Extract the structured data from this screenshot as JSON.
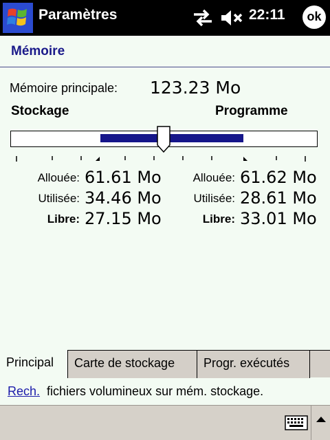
{
  "titlebar": {
    "app_title": "Paramètres",
    "clock": "22:11",
    "ok_label": "ok",
    "icons": [
      "windows-start-icon",
      "sync-arrows-icon",
      "volume-muted-icon"
    ]
  },
  "page": {
    "title": "Mémoire"
  },
  "memory": {
    "main_label": "Mémoire principale:",
    "main_value": "123.23 Mo",
    "storage_label": "Stockage",
    "program_label": "Programme",
    "slider_position_fraction": 0.5,
    "storage": {
      "allocated_label": "Allouée:",
      "allocated_value": "61.61 Mo",
      "used_label": "Utilisée:",
      "used_value": "34.46 Mo",
      "free_label": "Libre:",
      "free_value": "27.15 Mo"
    },
    "program": {
      "allocated_label": "Allouée:",
      "allocated_value": "61.62 Mo",
      "used_label": "Utilisée:",
      "used_value": "28.61 Mo",
      "free_label": "Libre:",
      "free_value": "33.01 Mo"
    }
  },
  "tabs": [
    {
      "label": "Principal",
      "active": true
    },
    {
      "label": "Carte de stockage",
      "active": false
    },
    {
      "label": "Progr. exécutés",
      "active": false
    }
  ],
  "footer": {
    "link_text": "Rech.",
    "note_text": "fichiers volumineux sur mém. stockage."
  },
  "colors": {
    "accent": "#16168a",
    "title_text": "#1a1a8a",
    "link": "#1a1aaa",
    "background": "#f3fbf3",
    "tab_background": "#d4cfc8"
  }
}
